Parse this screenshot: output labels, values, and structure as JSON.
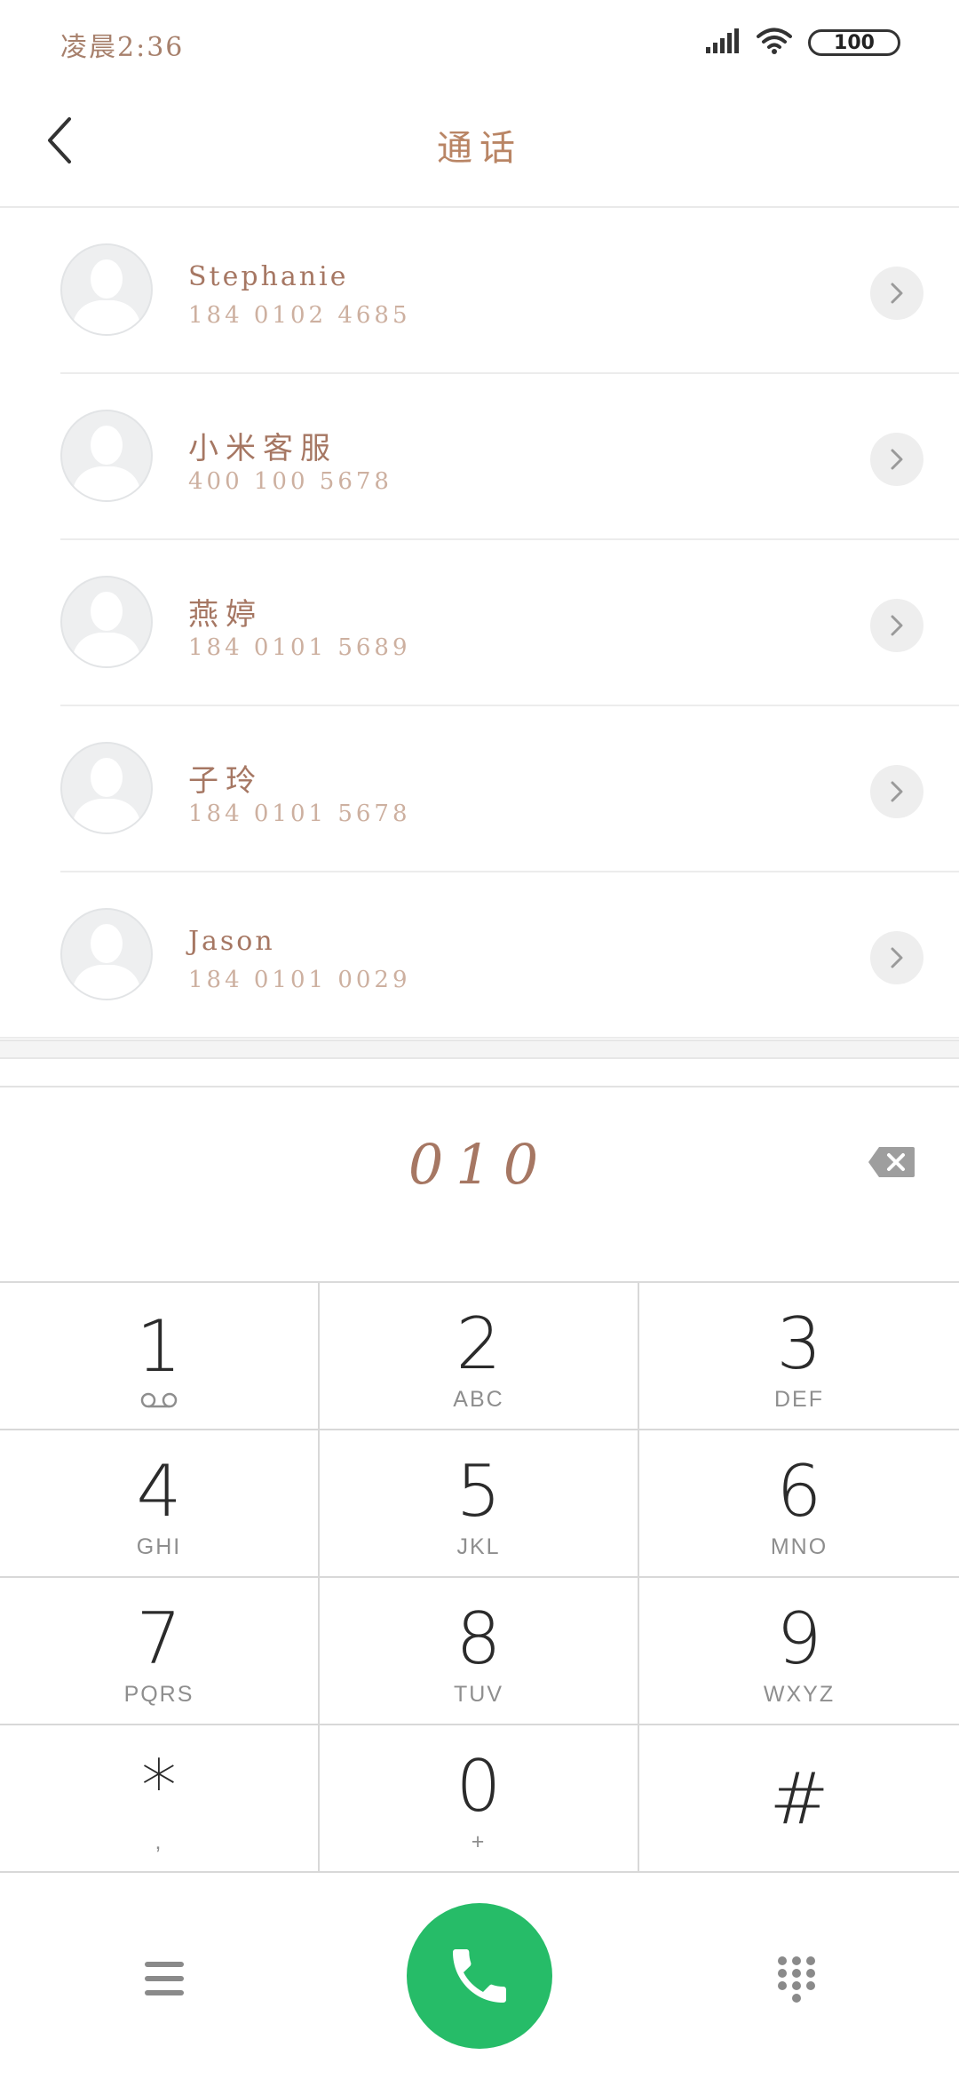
{
  "status_bar": {
    "time": "凌晨2:36",
    "battery": "100",
    "icons": [
      "signal-icon",
      "wifi-icon",
      "battery-icon"
    ]
  },
  "header": {
    "title": "通话",
    "back_icon": "chevron-left-icon"
  },
  "contacts": [
    {
      "name": "Stephanie",
      "number": "184 0102 4685"
    },
    {
      "name": "小米客服",
      "number": "400 100 5678"
    },
    {
      "name": "燕婷",
      "number": "184 0101 5689"
    },
    {
      "name": "子玲",
      "number": "184 0101 5678"
    },
    {
      "name": "Jason",
      "number": "184 0101 0029"
    }
  ],
  "dialer": {
    "input": "010",
    "backspace_icon": "backspace-icon"
  },
  "keypad": [
    {
      "digit": "1",
      "letters": ""
    },
    {
      "digit": "2",
      "letters": "ABC"
    },
    {
      "digit": "3",
      "letters": "DEF"
    },
    {
      "digit": "4",
      "letters": "GHI"
    },
    {
      "digit": "5",
      "letters": "JKL"
    },
    {
      "digit": "6",
      "letters": "MNO"
    },
    {
      "digit": "7",
      "letters": "PQRS"
    },
    {
      "digit": "8",
      "letters": "TUV"
    },
    {
      "digit": "9",
      "letters": "WXYZ"
    },
    {
      "digit": "*",
      "letters": ","
    },
    {
      "digit": "0",
      "letters": "+"
    },
    {
      "digit": "#",
      "letters": ""
    }
  ],
  "bottom_bar": {
    "menu_icon": "menu-icon",
    "call_icon": "phone-icon",
    "keypad_icon": "dialpad-icon",
    "call_color": "#26bc68"
  },
  "colors": {
    "accent_text": "#a67763",
    "secondary_text": "#cdb0a0",
    "call_green": "#26bc68"
  }
}
